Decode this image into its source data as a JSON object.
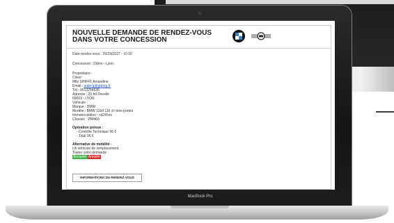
{
  "device": {
    "label": "MacBook Pro"
  },
  "document": {
    "title_line1": "NOUVELLE DEMANDE DE RENDEZ-VOUS",
    "title_line2": "DANS VOTRE CONCESSION",
    "date_line": "Date rendez-vous : 09/29/2017 - 10:30",
    "concession_line": "Concession : Dâmo - Lyon",
    "owner": {
      "heading": "Propriétaire :",
      "client_heading": "Client :",
      "name": "Mlle SHIFFF Amandine",
      "email_label": "Email :",
      "email": "alabcg@gtbmg.fr",
      "phone": "Tél : 0612254636",
      "address": "Adresse : 25 bd Decelle",
      "city": "69003 - LYON"
    },
    "vehicle": {
      "heading": "Véhicule :",
      "brand": "Marque : BMW",
      "model": "Modèle : BMW 116d 116 ch trois portes",
      "registration": "Immatriculation : cd245es",
      "chassis": "Chassis : 2f4f460"
    },
    "operation": {
      "heading": "Opération prévue :",
      "item": "- Contrôle Technique 96 €",
      "total": "- Total 96 €"
    },
    "mobility": {
      "heading": "Alternative de mobilité :",
      "text": "Un véhicule de remplacement.",
      "treat_label": "Traiter votre demande :",
      "accept_label": "Accepter",
      "refuse_label": "Annuler"
    },
    "info_button_label": "INFORMATIONS DU RENDEZ-VOUS"
  },
  "colors": {
    "accept": "#3fae49",
    "refuse": "#d42b2b",
    "link": "#2a56c6",
    "bmw_blue": "#3f7fd6"
  },
  "icons": [
    "bmw-logo-icon",
    "mini-logo-icon",
    "camera-icon"
  ]
}
